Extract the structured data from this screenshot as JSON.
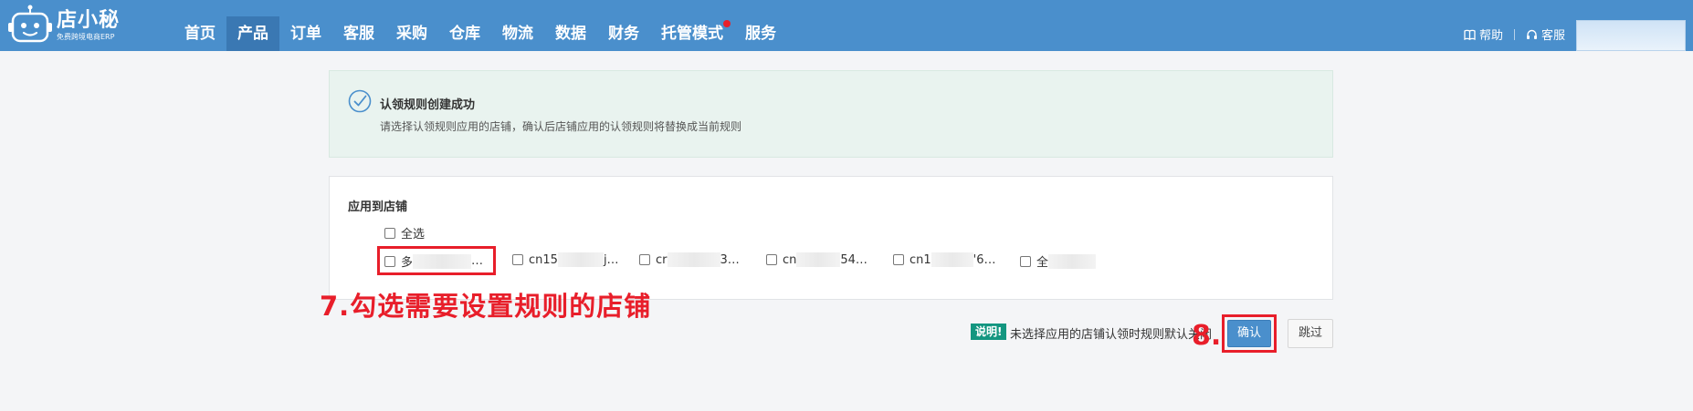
{
  "brand": {
    "title": "店小秘",
    "subtitle": "免费跨境电商ERP"
  },
  "nav": [
    {
      "label": "首页",
      "active": false
    },
    {
      "label": "产品",
      "active": true
    },
    {
      "label": "订单",
      "active": false
    },
    {
      "label": "客服",
      "active": false
    },
    {
      "label": "采购",
      "active": false
    },
    {
      "label": "仓库",
      "active": false
    },
    {
      "label": "物流",
      "active": false
    },
    {
      "label": "数据",
      "active": false
    },
    {
      "label": "财务",
      "active": false
    },
    {
      "label": "托管模式",
      "active": false,
      "badge": "red-dot"
    },
    {
      "label": "服务",
      "active": false
    }
  ],
  "header_right": {
    "help": "帮助",
    "service": "客服"
  },
  "success": {
    "icon": "check-circle-icon",
    "title": "认领规则创建成功",
    "description": "请选择认领规则应用的店铺，确认后店铺应用的认领规则将替换成当前规则"
  },
  "apply": {
    "title": "应用到店铺",
    "select_all": "全选",
    "stores": [
      {
        "prefix": "多",
        "suffix": "…"
      },
      {
        "prefix": "cn15",
        "suffix": "j…"
      },
      {
        "prefix": "cr",
        "suffix": "3…"
      },
      {
        "prefix": "cn",
        "suffix": "54…"
      },
      {
        "prefix": "cn1",
        "suffix": "'6…"
      },
      {
        "prefix": "全",
        "suffix": ""
      }
    ]
  },
  "annotations": {
    "step7": "7.勾选需要设置规则的店铺",
    "step8": "8."
  },
  "footer": {
    "note_badge": "说明!",
    "note_text": "未选择应用的店铺认领时规则默认关闭",
    "confirm": "确认",
    "skip": "跳过"
  },
  "colors": {
    "header": "#4a8fcc",
    "active_nav": "#3a78b3",
    "annotation_red": "#e81e2a",
    "note_green": "#139680",
    "success_bg": "#e9f3ef"
  }
}
